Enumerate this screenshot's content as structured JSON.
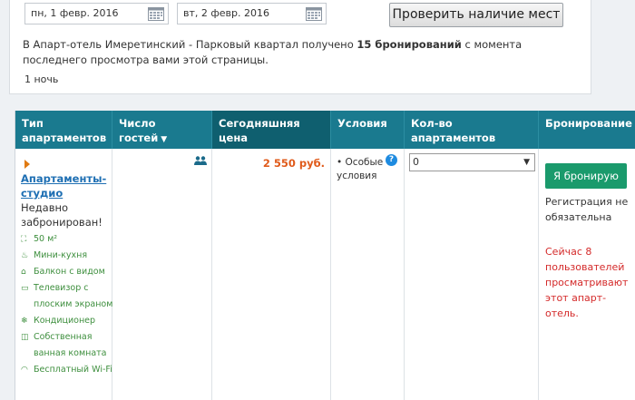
{
  "search": {
    "checkin": "пн, 1 февр. 2016",
    "checkout": "вт, 2 февр. 2016",
    "check_button": "Проверить наличие мест"
  },
  "notice": {
    "prefix": "В Апарт-отель Имеретинский - Парковый квартал получено ",
    "bold": "15 бронирований",
    "suffix": " с момента последнего просмотра вами этой страницы."
  },
  "nights": "1 ночь",
  "table": {
    "headers": {
      "type": "Тип апартаментов",
      "guests": "Число гостей",
      "guests_caret": "▼",
      "price": "Сегодняшняя цена",
      "conditions": "Условия",
      "qty": "Кол-во апартаментов",
      "booking": "Бронирование"
    },
    "room": {
      "name": "Апартаменты-студио",
      "status": "Недавно забронирован!",
      "amenities": [
        {
          "icon": "area-icon",
          "glyph": "⛶",
          "text": "50 м²"
        },
        {
          "icon": "kitchen-icon",
          "glyph": "♨",
          "text": "Мини-кухня"
        },
        {
          "icon": "balcony-icon",
          "glyph": "⌂",
          "text": "Балкон с видом"
        },
        {
          "icon": "tv-icon",
          "glyph": "▭",
          "text": "Телевизор с плоским экраном"
        },
        {
          "icon": "ac-icon",
          "glyph": "❄",
          "text": "Кондиционер"
        },
        {
          "icon": "bathroom-icon",
          "glyph": "◫",
          "text": "Собственная ванная комната"
        },
        {
          "icon": "wifi-icon",
          "glyph": "◠",
          "text": "Бесплатный Wi-Fi"
        }
      ],
      "price": "2 550 руб.",
      "conditions": "• Особые условия",
      "help": "?",
      "qty_selected": "0",
      "book_button": "Я бронирую",
      "registration_note": "Регистрация не обязательна",
      "watchers": "Сейчас 8 пользователей просматривают этот апарт-отель."
    }
  },
  "colors": {
    "header_bg": "#1a7a8f",
    "header_active": "#0f5f6f",
    "link": "#1e6fb3",
    "price": "#e05a1a",
    "amenity": "#3e8f3e",
    "book_button": "#1a9a6c",
    "alert": "#d42a2a"
  }
}
